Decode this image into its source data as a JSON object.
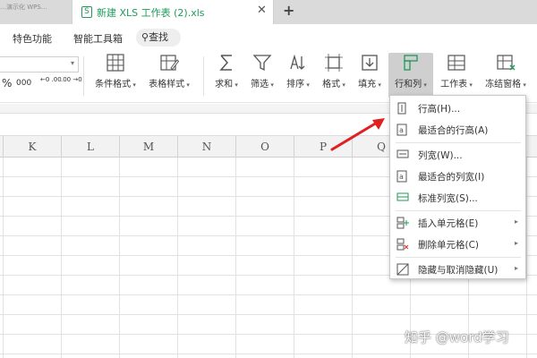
{
  "titlebar": {
    "prev_tab_fragment": "…演示化 WPS…",
    "active_tab_title": "新建 XLS 工作表 (2).xls",
    "close_glyph": "✕",
    "new_tab_glyph": "+"
  },
  "ribbon_tabs": {
    "features": "特色功能",
    "smart_toolbox": "智能工具箱",
    "search": "查找"
  },
  "number_format": {
    "percent": "%",
    "thousands": "000",
    "inc_decimal": "←0 .00",
    "dec_decimal": ".00 →0"
  },
  "toolbar": [
    {
      "label": "条件格式",
      "icon": "conditional-format-icon"
    },
    {
      "label": "表格样式",
      "icon": "table-style-icon"
    },
    {
      "label": "求和",
      "icon": "sum-icon"
    },
    {
      "label": "筛选",
      "icon": "filter-icon"
    },
    {
      "label": "排序",
      "icon": "sort-icon"
    },
    {
      "label": "格式",
      "icon": "format-icon"
    },
    {
      "label": "填充",
      "icon": "fill-icon"
    },
    {
      "label": "行和列",
      "icon": "row-col-icon"
    },
    {
      "label": "工作表",
      "icon": "worksheet-icon"
    },
    {
      "label": "冻结窗格",
      "icon": "freeze-panes-icon"
    }
  ],
  "columns": [
    "K",
    "L",
    "M",
    "N",
    "O",
    "P",
    "Q"
  ],
  "menu": {
    "items": [
      {
        "label": "行高(H)...",
        "icon": "row-height-icon",
        "submenu": false
      },
      {
        "label": "最适合的行高(A)",
        "icon": "autofit-row-icon",
        "submenu": false
      },
      {
        "label": "列宽(W)...",
        "icon": "column-width-icon",
        "submenu": false
      },
      {
        "label": "最适合的列宽(I)",
        "icon": "autofit-column-icon",
        "submenu": false
      },
      {
        "label": "标准列宽(S)...",
        "icon": "standard-width-icon",
        "submenu": false
      },
      {
        "label": "插入单元格(E)",
        "icon": "insert-cells-icon",
        "submenu": true
      },
      {
        "label": "删除单元格(C)",
        "icon": "delete-cells-icon",
        "submenu": true
      },
      {
        "label": "隐藏与取消隐藏(U)",
        "icon": "hide-unhide-icon",
        "submenu": true
      }
    ]
  },
  "watermark": "知乎 @word学习",
  "colors": {
    "accent_green": "#1e9a5a",
    "arrow_red": "#e02020",
    "selected_tool_bg": "#cfcfcf"
  }
}
